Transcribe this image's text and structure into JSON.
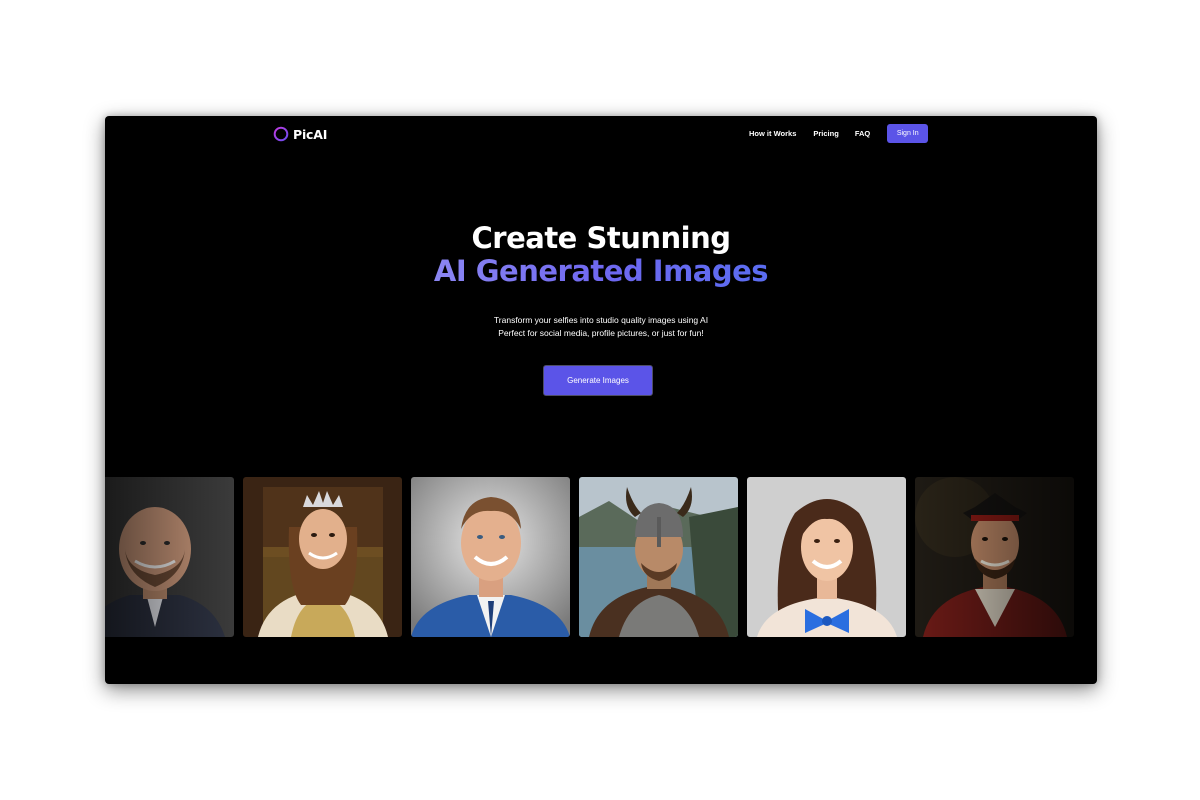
{
  "brand": {
    "name": "PicAI",
    "logo_icon": "ring-logo-icon",
    "accent_color": "#5b54e8",
    "logo_color": "#a04be8"
  },
  "nav": {
    "links": [
      {
        "label": "How it Works"
      },
      {
        "label": "Pricing"
      },
      {
        "label": "FAQ"
      }
    ],
    "signin_label": "Sign In"
  },
  "hero": {
    "title_line1": "Create Stunning",
    "title_line2": "AI Generated Images",
    "subtitle_line1": "Transform your selfies into studio quality images using AI",
    "subtitle_line2": "Perfect for social media, profile pictures, or just for fun!",
    "cta_label": "Generate Images"
  },
  "gallery": {
    "images": [
      {
        "subject": "man-in-suit-portrait"
      },
      {
        "subject": "queen-with-crown-portrait"
      },
      {
        "subject": "businessman-portrait"
      },
      {
        "subject": "viking-warrior-portrait"
      },
      {
        "subject": "woman-with-blue-bow-portrait"
      },
      {
        "subject": "pirate-portrait"
      }
    ]
  }
}
